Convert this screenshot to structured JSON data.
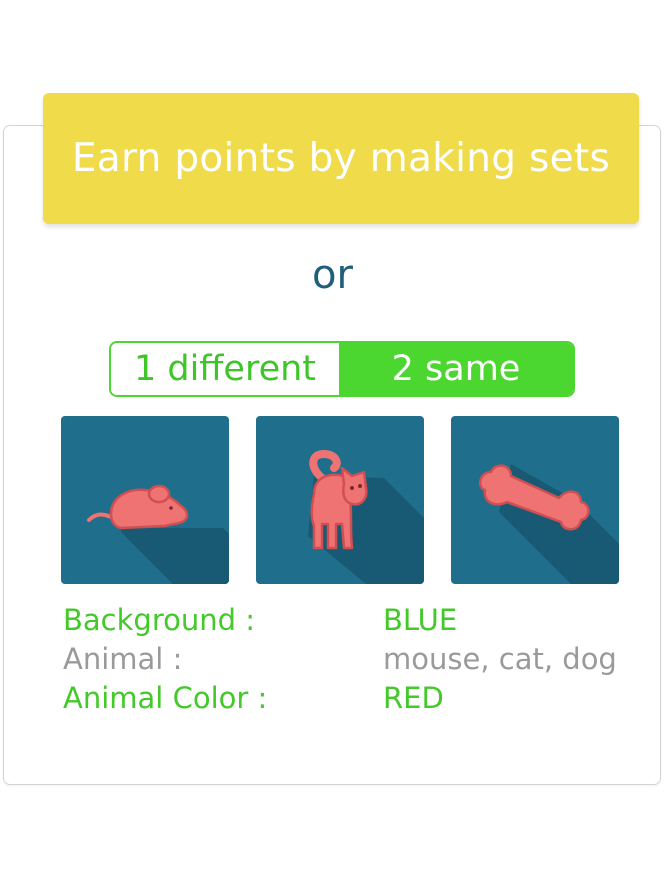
{
  "banner": {
    "text": "Earn points by making sets"
  },
  "separator": {
    "text": "or"
  },
  "toggle": {
    "left_label": "1 different",
    "right_label": "2 same",
    "selected": "right"
  },
  "cards": [
    {
      "animal": "mouse-icon",
      "background": "#1f6e8c",
      "animal_color": "#f07373"
    },
    {
      "animal": "cat-icon",
      "background": "#1f6e8c",
      "animal_color": "#f07373"
    },
    {
      "animal": "bone-icon",
      "background": "#1f6e8c",
      "animal_color": "#f07373"
    }
  ],
  "properties": [
    {
      "label": "Background :",
      "value": "BLUE",
      "status": "same"
    },
    {
      "label": "Animal :",
      "value": "mouse, cat, dog",
      "status": "different"
    },
    {
      "label": "Animal Color :",
      "value": "RED",
      "status": "same"
    }
  ],
  "colors": {
    "banner": "#f0db4a",
    "accent_green": "#4cd630",
    "text_gray": "#9a9a9a",
    "tile_blue": "#1f6e8c",
    "shadow_blue": "#185a73",
    "animal_red": "#f07373"
  }
}
